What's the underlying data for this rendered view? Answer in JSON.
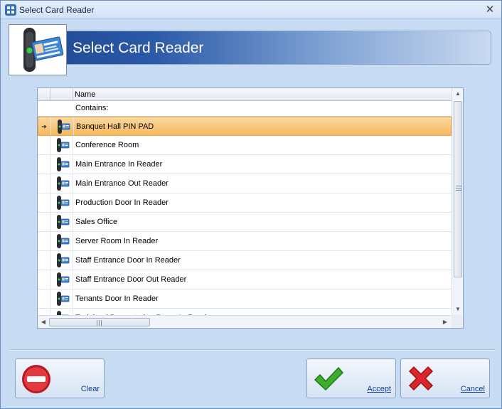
{
  "window": {
    "title": "Select Card Reader"
  },
  "header": {
    "title": "Select Card Reader"
  },
  "grid": {
    "columns": [
      "Name"
    ],
    "filter_label": "Contains:",
    "selected_index": 0,
    "rows": [
      {
        "name": "Banquet Hall PIN PAD"
      },
      {
        "name": "Conference Room"
      },
      {
        "name": "Main Entrance In Reader"
      },
      {
        "name": "Main Entrance Out Reader"
      },
      {
        "name": "Production Door In Reader"
      },
      {
        "name": "Sales Office"
      },
      {
        "name": "Server Room In Reader"
      },
      {
        "name": "Staff Entrance Door In Reader"
      },
      {
        "name": "Staff Entrance Door Out Reader"
      },
      {
        "name": "Tenants Door In Reader"
      },
      {
        "name": "Training / Presentation Room In Reader"
      }
    ]
  },
  "buttons": {
    "clear": "Clear",
    "accept": "Accept",
    "cancel": "Cancel"
  },
  "icons": {
    "app": "grid-app-icon",
    "header": "card-reader-with-id-card-icon",
    "row": "card-reader-icon",
    "clear": "no-entry-icon",
    "accept": "green-check-icon",
    "cancel": "red-x-icon"
  },
  "colors": {
    "selection": "#f7b95e",
    "header_blue": "#1d4690",
    "accept_green": "#3cae2c",
    "cancel_red": "#d8262c"
  }
}
